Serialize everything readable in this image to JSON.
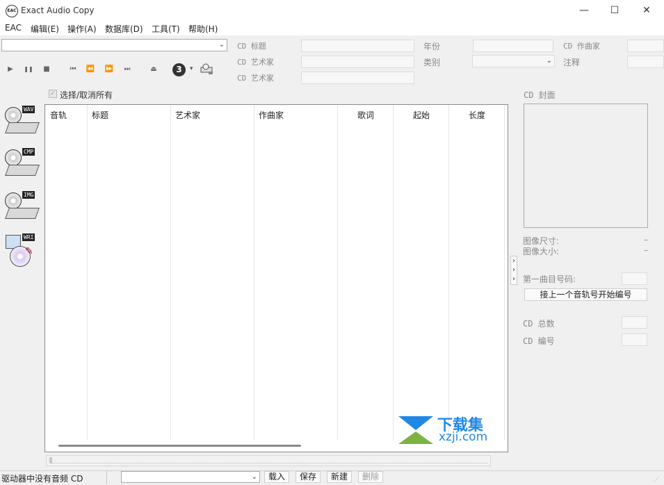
{
  "window": {
    "title": "Exact Audio Copy",
    "icon": "eac-logo-icon"
  },
  "window_controls": {
    "minimize": "—",
    "maximize": "☐",
    "close": "✕"
  },
  "menu": [
    {
      "label": "EAC"
    },
    {
      "label": "编辑(E)"
    },
    {
      "label": "操作(A)"
    },
    {
      "label": "数据库(D)"
    },
    {
      "label": "工具(T)"
    },
    {
      "label": "帮助(H)"
    }
  ],
  "drive_select": {
    "value": ""
  },
  "metadata": {
    "cd_title_label": "CD 标题",
    "cd_artist_label": "CD 艺术家",
    "cd_artist2_label": "CD 艺术家",
    "year_label": "年份",
    "genre_label": "类别",
    "composer_label": "CD 作曲家",
    "comment_label": "注释",
    "cd_title": "",
    "cd_artist": "",
    "cd_artist2": "",
    "year": "",
    "genre": "",
    "composer": "",
    "comment": ""
  },
  "transport": {
    "play": "▶",
    "pause": "❚❚",
    "stop": "■",
    "first": "⏮",
    "rewind": "⏪",
    "forward": "⏩",
    "last": "⏭",
    "eject": "⏏",
    "speed": "3",
    "speed_arrow": "▾"
  },
  "select_all_label": "选择/取消所有",
  "tools": [
    {
      "tag": "WAV",
      "icon": "extract-wav-icon"
    },
    {
      "tag": "CMP",
      "icon": "extract-compressed-icon"
    },
    {
      "tag": "IMG",
      "icon": "copy-image-icon"
    },
    {
      "tag": "WRI",
      "icon": "write-cd-icon"
    }
  ],
  "columns": [
    "音轨",
    "标题",
    "艺术家",
    "作曲家",
    "歌词",
    "起始",
    "长度"
  ],
  "collapse_arrows": "›\n›\n›",
  "right_panel": {
    "cover_label": "CD 封面",
    "image_size_label": "图像尺寸:",
    "image_size_value": "–",
    "image_bytes_label": "图像大小:",
    "image_bytes_value": "–",
    "first_track_label": "第一曲目号码:",
    "first_track_value": "",
    "continue_numbering_button": "接上一个音轨号开始编号",
    "cd_total_label": "CD 总数",
    "cd_total_value": "",
    "cd_number_label": "CD 编号",
    "cd_number_value": ""
  },
  "watermark": {
    "text_cn": "下载集",
    "text_url": "xzji.com"
  },
  "status": {
    "message": "驱动器中没有音频 CD",
    "profile_value": "",
    "load_button": "载入",
    "save_button": "保存",
    "new_button": "新建",
    "delete_button": "删除"
  },
  "colors": {
    "watermark_blue": "#1e88e5",
    "list_border": "#8a8a8a",
    "disabled_text": "#888888"
  }
}
